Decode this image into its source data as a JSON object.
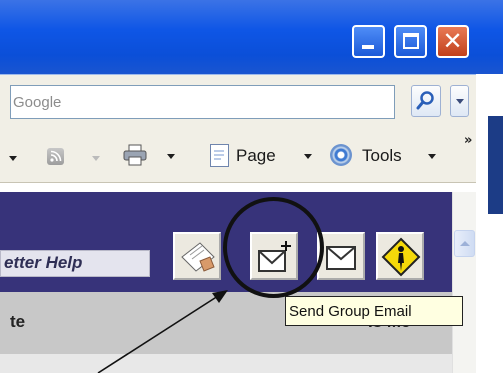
{
  "browser": {
    "search": {
      "placeholder": "Google"
    },
    "toolbar": {
      "page_label": "Page",
      "tools_label": "Tools",
      "more_label": "»"
    }
  },
  "window_buttons": {
    "close_glyph": "✕"
  },
  "page": {
    "help_button_label": "etter Help",
    "header": {
      "left_column": "te",
      "right_column": "Is Me"
    }
  },
  "tooltip": {
    "text": "Send Group Email"
  },
  "icons": [
    "rss-feed-icon",
    "printer-icon",
    "page-icon",
    "gear-icon",
    "search-icon",
    "minimize-icon",
    "maximize-icon",
    "close-icon",
    "letter-edit-icon",
    "send-group-email-icon",
    "email-icon",
    "road-sign-icon"
  ],
  "colors": {
    "titlebar": "#0f56e6",
    "page_header": "#37337a",
    "tooltip_bg": "#ffffe1",
    "annotation": "#111111"
  }
}
